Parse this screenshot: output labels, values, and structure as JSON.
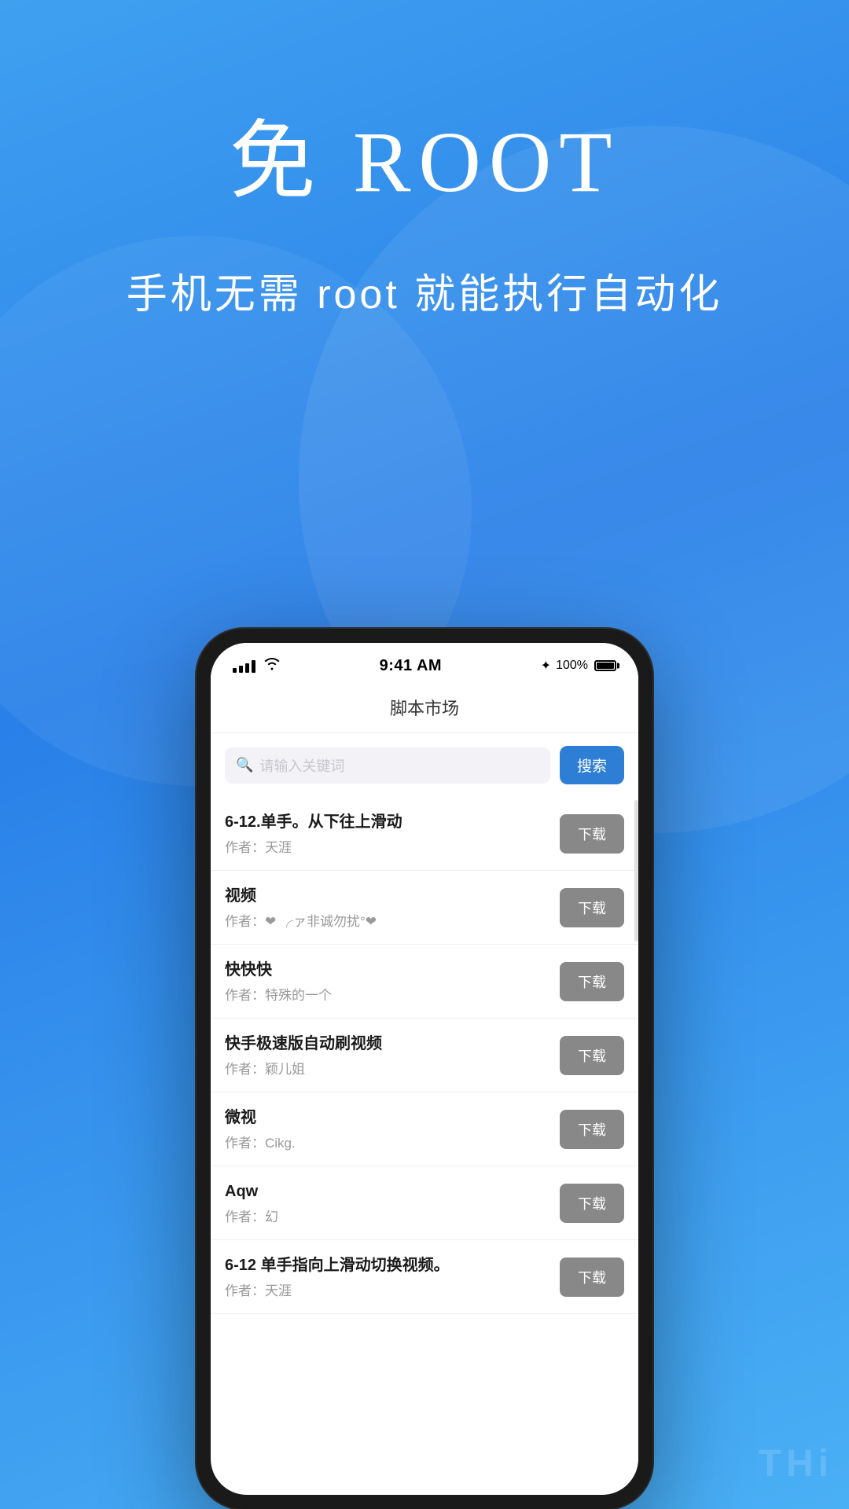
{
  "hero": {
    "title": "免 ROOT",
    "subtitle": "手机无需 root 就能执行自动化"
  },
  "status_bar": {
    "time": "9:41 AM",
    "battery_percent": "100%",
    "bluetooth": "✦"
  },
  "app_header": {
    "title": "脚本市场"
  },
  "search": {
    "placeholder": "请输入关键词",
    "button_label": "搜索"
  },
  "scripts": [
    {
      "name": "6-12.单手。从下往上滑动",
      "author": "作者：天涯",
      "download_label": "下载"
    },
    {
      "name": "视频",
      "author": "作者：❤ ╭ァ非诚勿扰°❤",
      "download_label": "下载"
    },
    {
      "name": "快快快",
      "author": "作者：特殊的一个",
      "download_label": "下载"
    },
    {
      "name": "快手极速版自动刷视频",
      "author": "作者：颖儿姐",
      "download_label": "下载"
    },
    {
      "name": "微视",
      "author": "作者：Cikg.",
      "download_label": "下载"
    },
    {
      "name": "Aqw",
      "author": "作者：幻",
      "download_label": "下载"
    },
    {
      "name": "6-12  单手指向上滑动切换视频。",
      "author": "作者：天涯",
      "download_label": "下载"
    }
  ],
  "bottom_label": "THi"
}
